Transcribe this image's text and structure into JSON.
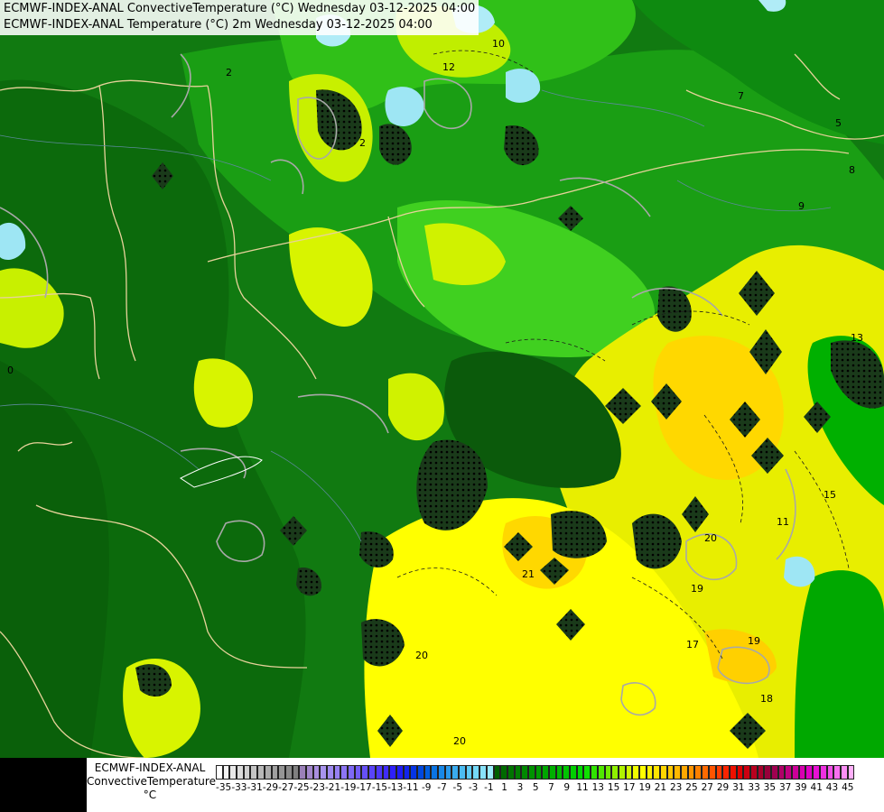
{
  "title_lines": [
    "ECMWF-INDEX-ANAL ConvectiveTemperature (°C) Wednesday 03-12-2025 04:00",
    "ECMWF-INDEX-ANAL Temperature (°C) 2m Wednesday 03-12-2025 04:00"
  ],
  "legend": {
    "title_lines": [
      "ECMWF-INDEX-ANAL",
      "ConvectiveTemperature",
      "°C"
    ],
    "tick_labels": [
      "-35",
      "-33",
      "-31",
      "-29",
      "-27",
      "-25",
      "-23",
      "-21",
      "-19",
      "-17",
      "-15",
      "-13",
      "-11",
      "-9",
      "-7",
      "-5",
      "-3",
      "-1",
      "1",
      "3",
      "5",
      "7",
      "9",
      "11",
      "13",
      "15",
      "17",
      "19",
      "21",
      "23",
      "25",
      "27",
      "29",
      "31",
      "33",
      "35",
      "37",
      "39",
      "41",
      "43",
      "45"
    ],
    "colors": [
      "#ffffff",
      "#f4f4f4",
      "#e8e8e8",
      "#dcdcdc",
      "#d0d0d0",
      "#c4c4c4",
      "#b8b8b8",
      "#acacac",
      "#a0a0a0",
      "#959595",
      "#8a8a8a",
      "#808080",
      "#9a80b8",
      "#a287cc",
      "#a98ee0",
      "#a894ee",
      "#9f8af0",
      "#9680f2",
      "#8c75f4",
      "#7f69f5",
      "#735df6",
      "#6650f7",
      "#5944f8",
      "#4c38f9",
      "#402cfa",
      "#2e20fb",
      "#1f1cf5",
      "#1224ee",
      "#0634e6",
      "#0048e0",
      "#005ee0",
      "#0a74e4",
      "#1888e8",
      "#2a9aec",
      "#3aabef",
      "#4cbcf2",
      "#60ccf5",
      "#74d8f7",
      "#88e2f9",
      "#9cecfb",
      "#006000",
      "#006a00",
      "#007400",
      "#007e00",
      "#008800",
      "#009200",
      "#009c00",
      "#00a600",
      "#00b000",
      "#00ba00",
      "#00c400",
      "#00ce00",
      "#00d800",
      "#10e000",
      "#30e400",
      "#50e800",
      "#70ec00",
      "#90f000",
      "#b0f400",
      "#d0f800",
      "#f0fc00",
      "#ffff00",
      "#fff200",
      "#ffe400",
      "#ffd600",
      "#ffc800",
      "#ffb800",
      "#ffa800",
      "#ff9400",
      "#ff8000",
      "#ff6a00",
      "#ff5400",
      "#ff3c00",
      "#f82400",
      "#ee1000",
      "#e00000",
      "#cc0010",
      "#b8001e",
      "#a8002c",
      "#98003a",
      "#a00050",
      "#b00068",
      "#c00080",
      "#cc0098",
      "#d800b0",
      "#e000c4",
      "#e810d4",
      "#ee30e0",
      "#f250e8",
      "#f870f0",
      "#fc90f6",
      "#ffb0fa"
    ]
  },
  "contour_labels": [
    {
      "text": "12"
    },
    {
      "text": "10"
    },
    {
      "text": "2"
    },
    {
      "text": "7"
    },
    {
      "text": "5"
    },
    {
      "text": "8"
    },
    {
      "text": "9"
    },
    {
      "text": "20"
    },
    {
      "text": "21"
    },
    {
      "text": "19"
    },
    {
      "text": "17"
    },
    {
      "text": "18"
    },
    {
      "text": "19"
    },
    {
      "text": "20"
    },
    {
      "text": "20"
    },
    {
      "text": "15"
    },
    {
      "text": "13"
    },
    {
      "text": "11"
    },
    {
      "text": "0"
    },
    {
      "text": "2"
    }
  ]
}
